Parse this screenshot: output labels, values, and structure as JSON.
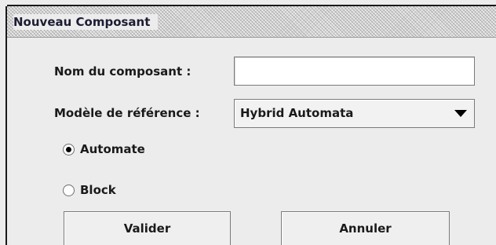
{
  "dialog": {
    "title": "Nouveau Composant"
  },
  "form": {
    "name_label": "Nom du composant :",
    "name_value": "",
    "model_label": "Modèle de référence :",
    "model_selected": "Hybrid Automata"
  },
  "type_options": [
    {
      "label": "Automate",
      "checked": true
    },
    {
      "label": "Block",
      "checked": false
    }
  ],
  "buttons": {
    "validate_label": "Valider",
    "cancel_label": "Annuler"
  },
  "icons": {
    "combo_arrow": "chevron-down-icon",
    "radio": "radio-icon"
  }
}
